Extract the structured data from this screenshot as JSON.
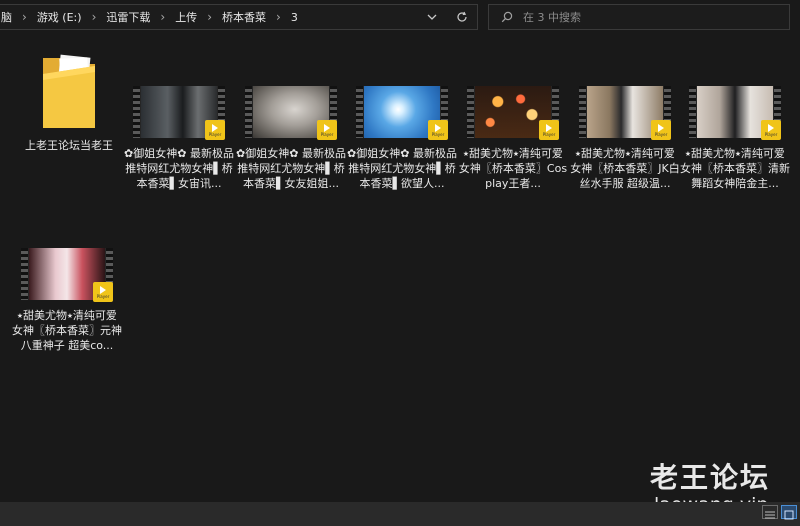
{
  "address_bar": {
    "crumbs": [
      "脑",
      "游戏 (E:)",
      "迅雷下载",
      "上传",
      "桥本香菜",
      "3"
    ],
    "dropdown_icon": "chevron-down-icon",
    "refresh_icon": "refresh-icon"
  },
  "search": {
    "placeholder": "在 3 中搜索",
    "icon": "search-icon"
  },
  "items": [
    {
      "name": "上老王论坛当老王",
      "type": "folder"
    },
    {
      "name": "✿御姐女神✿ 最新极品推特网红尤物女神▌桥本香菜▌女宙讯...",
      "type": "video",
      "thumb": "dark-room"
    },
    {
      "name": "✿御姐女神✿ 最新极品推特网红尤物女神▌桥本香菜▌女友姐姐...",
      "type": "video",
      "thumb": "heels"
    },
    {
      "name": "✿御姐女神✿ 最新极品推特网红尤物女神▌桥本香菜▌欲望人...",
      "type": "video",
      "thumb": "sky"
    },
    {
      "name": "⭑甜美尤物⭑清纯可爱女神〖桥本香菜〗Cosplay王者...",
      "type": "video",
      "thumb": "bokeh"
    },
    {
      "name": "⭑甜美尤物⭑清纯可爱女神〖桥本香菜〗JK白丝水手服 超级温...",
      "type": "video",
      "thumb": "room"
    },
    {
      "name": "⭑甜美尤物⭑清纯可爱女神〖桥本香菜〗清新舞蹈女神陪金主...",
      "type": "video",
      "thumb": "bedroom"
    },
    {
      "name": "⭑甜美尤物⭑清纯可爱女神〖桥本香菜〗元神八重神子 超美co...",
      "type": "video",
      "thumb": "cosplay"
    }
  ],
  "player_badge": "Player",
  "watermark": {
    "title": "老王论坛",
    "url": "laowang.vip"
  },
  "colors": {
    "background": "#191919",
    "folder": "#f3c54a",
    "badge": "#f0c419",
    "statusbar": "#2a2a2a"
  }
}
